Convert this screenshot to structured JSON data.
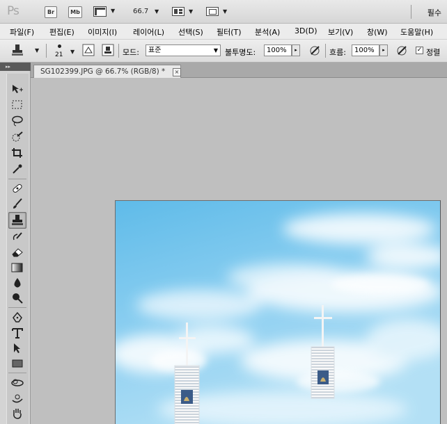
{
  "appbar": {
    "logo": "Ps",
    "bridge_label": "Br",
    "minibridge_label": "Mb",
    "zoom": "66.7",
    "workspace": "필수"
  },
  "menu": [
    "파일(F)",
    "편집(E)",
    "이미지(I)",
    "레이어(L)",
    "선택(S)",
    "필터(T)",
    "분석(A)",
    "3D(D)",
    "보기(V)",
    "창(W)",
    "도움말(H)"
  ],
  "options": {
    "brush_size": "21",
    "mode_label": "모드:",
    "mode_value": "표준",
    "opacity_label": "불투명도:",
    "opacity_value": "100%",
    "flow_label": "흐름:",
    "flow_value": "100%",
    "aligned_label": "정렬"
  },
  "toolbox": {
    "collapse_label": "▸▸"
  },
  "document": {
    "tab_title": "SG102399.JPG @ 66.7% (RGB/8) *",
    "close_glyph": "×"
  },
  "colors": {
    "sky_top": "#6ec3ec",
    "sky_bottom": "#a9dcf3",
    "cloud": "#ffffff",
    "tower": "#f0f0f0"
  }
}
